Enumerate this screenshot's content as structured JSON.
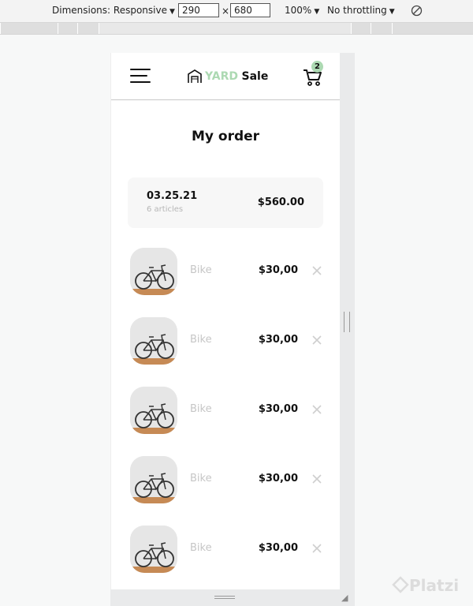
{
  "devtools": {
    "dimensions_label": "Dimensions: Responsive",
    "width": "290",
    "times": "×",
    "height": "680",
    "zoom": "100%",
    "throttling": "No throttling"
  },
  "header": {
    "logo_yard": "YARD",
    "logo_sale": "Sale",
    "cart_count": "2"
  },
  "page_title": "My order",
  "order": {
    "date": "03.25.21",
    "articles": "6 articles",
    "total": "$560.00"
  },
  "items": [
    {
      "name": "Bike",
      "price": "$30,00"
    },
    {
      "name": "Bike",
      "price": "$30,00"
    },
    {
      "name": "Bike",
      "price": "$30,00"
    },
    {
      "name": "Bike",
      "price": "$30,00"
    },
    {
      "name": "Bike",
      "price": "$30,00"
    }
  ],
  "watermark": "Platzi",
  "colors": {
    "accent_green": "#acd9b2",
    "summary_bg": "#f7f7f7",
    "muted_text": "#c6c6c6"
  }
}
